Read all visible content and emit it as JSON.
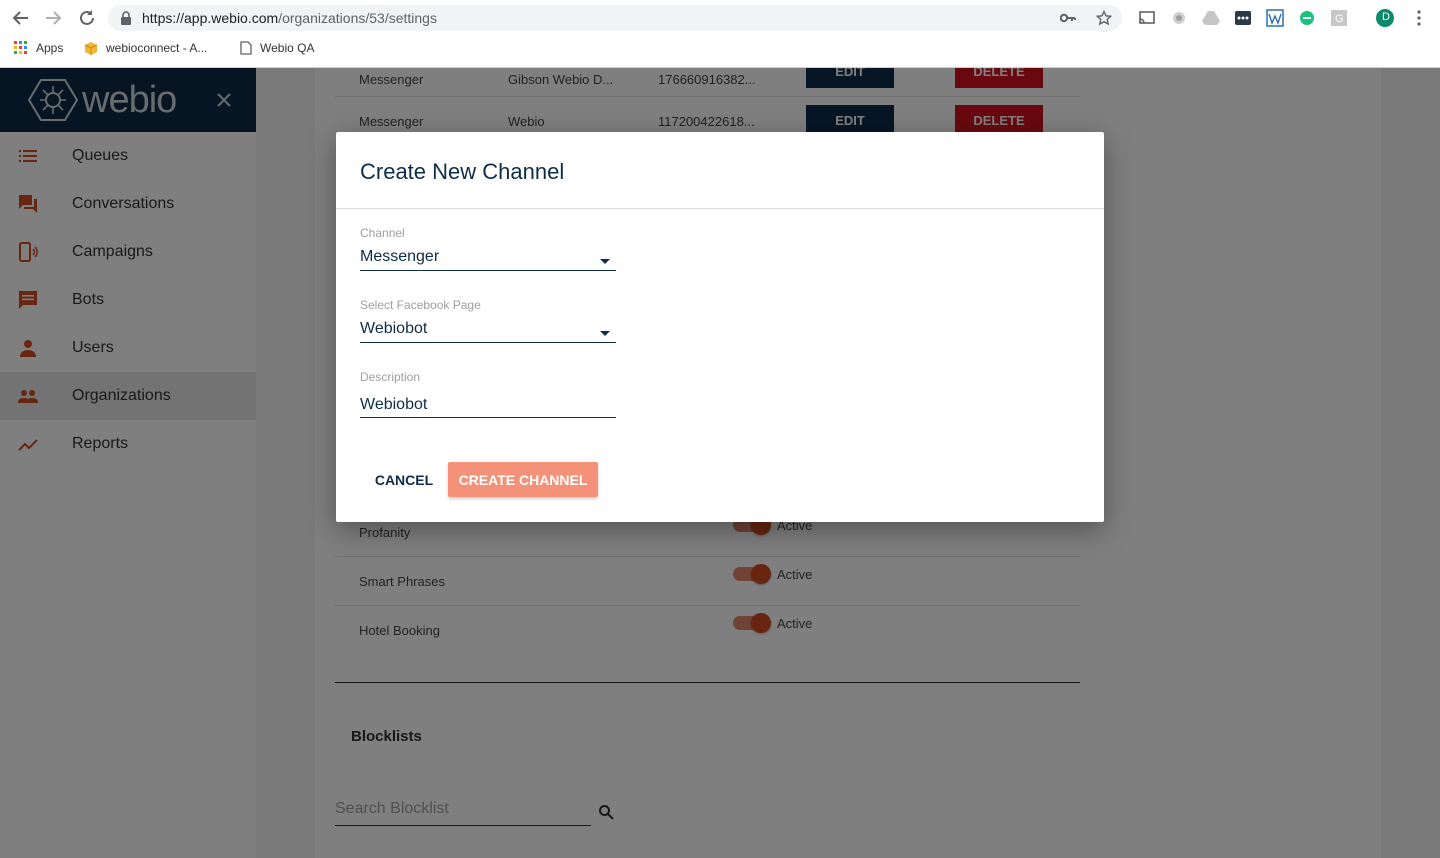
{
  "browser": {
    "url_host": "https://app.webio.com",
    "url_path": "/organizations/53/settings",
    "bookmarks": [
      {
        "label": "Apps"
      },
      {
        "label": "webioconnect - A..."
      },
      {
        "label": "Webio QA"
      }
    ],
    "profile_initial": "D"
  },
  "sidebar": {
    "logo_text": "webio",
    "items": [
      {
        "label": "Queues",
        "icon": "list-icon"
      },
      {
        "label": "Conversations",
        "icon": "forum-icon"
      },
      {
        "label": "Campaigns",
        "icon": "phone-broadcast-icon"
      },
      {
        "label": "Bots",
        "icon": "chat-bubble-icon"
      },
      {
        "label": "Users",
        "icon": "person-icon"
      },
      {
        "label": "Organizations",
        "icon": "people-icon"
      },
      {
        "label": "Reports",
        "icon": "trending-up-icon"
      }
    ],
    "active_item": "Organizations"
  },
  "channels_table": {
    "rows": [
      {
        "channel": "Messenger",
        "name": "Gibson Webio D...",
        "id": "176660916382...",
        "edit": "EDIT",
        "delete": "DELETE"
      },
      {
        "channel": "Messenger",
        "name": "Webio",
        "id": "117200422618...",
        "edit": "EDIT",
        "delete": "DELETE"
      }
    ]
  },
  "features": {
    "rows": [
      {
        "name": "Profanity",
        "status": "Active",
        "enabled": true
      },
      {
        "name": "Smart Phrases",
        "status": "Active",
        "enabled": true
      },
      {
        "name": "Hotel Booking",
        "status": "Active",
        "enabled": true
      }
    ]
  },
  "blocklists": {
    "title": "Blocklists",
    "search_placeholder": "Search Blocklist"
  },
  "modal": {
    "title": "Create New Channel",
    "channel_label": "Channel",
    "channel_value": "Messenger",
    "page_label": "Select Facebook Page",
    "page_value": "Webiobot",
    "description_label": "Description",
    "description_value": "Webiobot",
    "cancel_label": "CANCEL",
    "create_label": "CREATE CHANNEL"
  },
  "colors": {
    "navy": "#0f2d4a",
    "accent": "#d04a1e",
    "create_button": "#f39279",
    "delete_button": "#d2121f"
  }
}
